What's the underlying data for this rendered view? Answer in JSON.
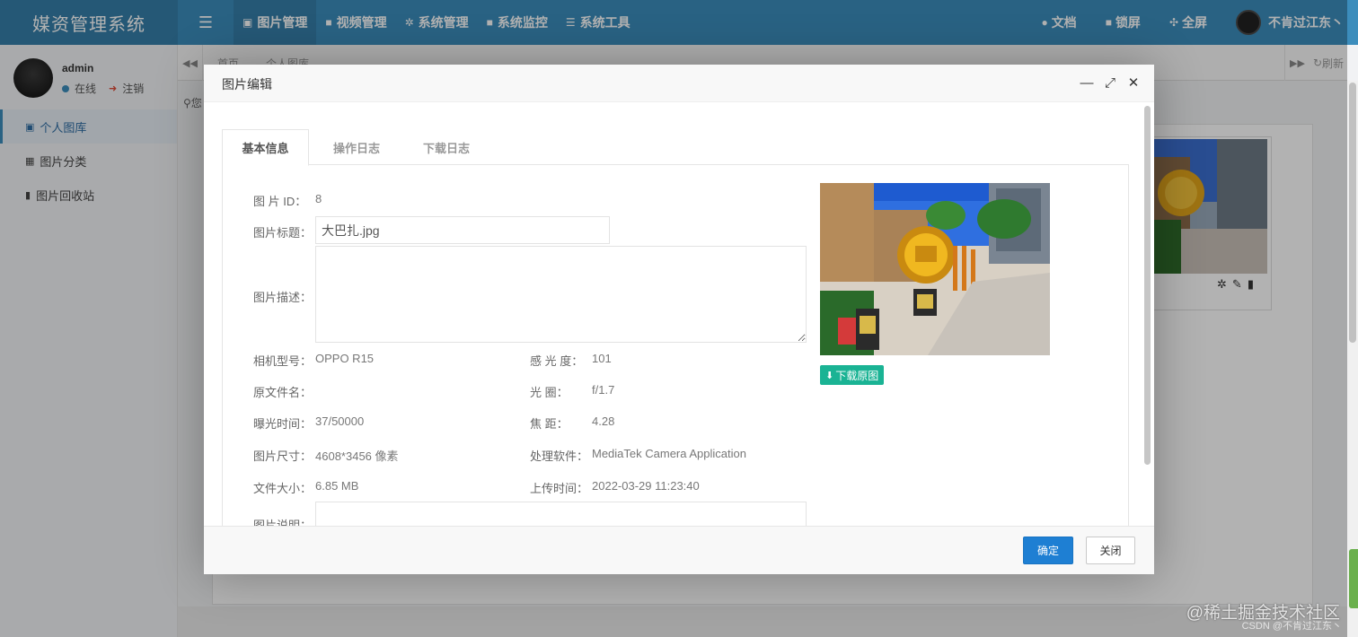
{
  "brand": "媒资管理系统",
  "top_nav": [
    {
      "icon": "image-icon",
      "glyph": "▣",
      "label": "图片管理"
    },
    {
      "icon": "video-icon",
      "glyph": "■",
      "label": "视频管理"
    },
    {
      "icon": "gear-icon",
      "glyph": "✲",
      "label": "系统管理"
    },
    {
      "icon": "camera-icon",
      "glyph": "■",
      "label": "系统监控"
    },
    {
      "icon": "list-icon",
      "glyph": "☰",
      "label": "系统工具"
    }
  ],
  "right_nav": {
    "docs": "文档",
    "lock": "锁屏",
    "fullscreen": "全屏",
    "username": "不肯过江东丶"
  },
  "user": {
    "name": "admin",
    "status": "在线",
    "logout": "注销"
  },
  "sidebar": [
    {
      "icon": "photo-icon",
      "glyph": "▣",
      "label": "个人图库"
    },
    {
      "icon": "calendar-icon",
      "glyph": "▦",
      "label": "图片分类"
    },
    {
      "icon": "trash-icon",
      "glyph": "▮",
      "label": "图片回收站"
    }
  ],
  "page_tabs": {
    "home": "首页",
    "current": "个人图库",
    "refresh": "刷新"
  },
  "breadcrumb": "您",
  "modal": {
    "title": "图片编辑",
    "tabs": [
      "基本信息",
      "操作日志",
      "下载日志"
    ],
    "fields": {
      "id_label": "图 片 ID：",
      "id_value": "8",
      "title_label": "图片标题：",
      "title_value": "大巴扎.jpg",
      "desc_label": "图片描述：",
      "camera_label": "相机型号：",
      "camera_value": "OPPO R15",
      "iso_label": "感 光 度：",
      "iso_value": "101",
      "origname_label": "原文件名：",
      "origname_value": "",
      "aperture_label": "光 圈：",
      "aperture_value": "f/1.7",
      "exposure_label": "曝光时间：",
      "exposure_value": "37/50000",
      "focal_label": "焦 距：",
      "focal_value": "4.28",
      "size_label": "图片尺寸：",
      "size_value": "4608*3456 像素",
      "software_label": "处理软件：",
      "software_value": "MediaTek Camera Application",
      "filesize_label": "文件大小：",
      "filesize_value": "6.85 MB",
      "upload_label": "上传时间：",
      "upload_value": "2022-03-29 11:23:40",
      "note_label": "图片说明："
    },
    "download_original": "下载原图",
    "ok": "确定",
    "close": "关闭"
  },
  "watermark": "@稀土掘金技术社区",
  "watermark2": "CSDN @不肯过江东丶",
  "colors": {
    "topbar": "#3c8dbc",
    "primary_button": "#1e7fd3",
    "download_button": "#1ab394"
  }
}
